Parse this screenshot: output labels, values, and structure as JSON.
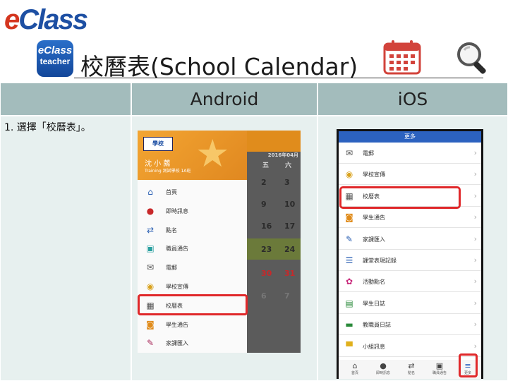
{
  "brand": {
    "e": "e",
    "rest": "Class"
  },
  "teacher_logo": {
    "line1": "eClass",
    "line2": "teacher"
  },
  "title": "校曆表(School Calendar)",
  "table": {
    "col_android": "Android",
    "col_ios": "iOS",
    "step1": "1. 選擇「校曆表」。"
  },
  "android": {
    "school_logo": "學校",
    "user_name": "沈 小 薦",
    "user_sub": "Training 測試學校 1A班",
    "calendar": {
      "month_label": "2016年04月",
      "weekdays": [
        "五",
        "六"
      ],
      "rows": [
        [
          "2",
          "3"
        ],
        [
          "9",
          "10"
        ],
        [
          "16",
          "17"
        ],
        [
          "23",
          "24"
        ],
        [
          "30",
          "31"
        ],
        [
          "6",
          "7"
        ]
      ]
    },
    "menu": [
      {
        "icon": "home-icon",
        "glyph": "⌂",
        "color": "#2a5fb3",
        "label": "首頁"
      },
      {
        "icon": "alert-icon",
        "glyph": "●",
        "color": "#c8282a",
        "label": "即時訊息"
      },
      {
        "icon": "swap-icon",
        "glyph": "⇄",
        "color": "#2a5fb3",
        "label": "點名"
      },
      {
        "icon": "notice-icon",
        "glyph": "▣",
        "color": "#2aa0a0",
        "label": "職員通告"
      },
      {
        "icon": "mail-icon",
        "glyph": "✉",
        "color": "#555555",
        "label": "電郵"
      },
      {
        "icon": "broadcast-icon",
        "glyph": "◉",
        "color": "#d9a21d",
        "label": "學校宣傳"
      },
      {
        "icon": "calendar-icon",
        "glyph": "▦",
        "color": "#555555",
        "label": "校曆表"
      },
      {
        "icon": "student-notice-icon",
        "glyph": "◙",
        "color": "#e08c1c",
        "label": "學生通告"
      },
      {
        "icon": "homework-icon",
        "glyph": "✎",
        "color": "#a8285a",
        "label": "家課匯入"
      }
    ]
  },
  "ios": {
    "header": "更多",
    "rows": [
      {
        "icon": "mail-icon",
        "glyph": "✉",
        "color": "#555555",
        "label": "電郵"
      },
      {
        "icon": "broadcast-icon",
        "glyph": "◉",
        "color": "#d9a21d",
        "label": "學校宣傳"
      },
      {
        "icon": "calendar-icon",
        "glyph": "▦",
        "color": "#555555",
        "label": "校曆表"
      },
      {
        "icon": "student-notice-icon",
        "glyph": "◙",
        "color": "#e08c1c",
        "label": "學生通告"
      },
      {
        "icon": "homework-icon",
        "glyph": "✎",
        "color": "#2a5fb3",
        "label": "家課匯入"
      },
      {
        "icon": "conduct-icon",
        "glyph": "☰",
        "color": "#2a5fb3",
        "label": "課堂表現記錄"
      },
      {
        "icon": "activity-icon",
        "glyph": "✿",
        "color": "#c8287a",
        "label": "活動點名"
      },
      {
        "icon": "diary-icon",
        "glyph": "▤",
        "color": "#2a8a3a",
        "label": "學生日誌"
      },
      {
        "icon": "ebook-icon",
        "glyph": "▬",
        "color": "#2a8a3a",
        "label": "教職員日誌"
      },
      {
        "icon": "group-message-icon",
        "glyph": "▀",
        "color": "#e0b01c",
        "label": "小組訊息"
      }
    ],
    "tabs": [
      {
        "icon": "home-icon",
        "glyph": "⌂",
        "label": "首頁"
      },
      {
        "icon": "alert-icon",
        "glyph": "●",
        "label": "即時訊息"
      },
      {
        "icon": "swap-icon",
        "glyph": "⇄",
        "label": "點名"
      },
      {
        "icon": "notice-icon",
        "glyph": "▣",
        "label": "職員通告"
      },
      {
        "icon": "more-icon",
        "glyph": "≡",
        "label": "更多"
      }
    ]
  },
  "colors": {
    "highlight": "#e0282a",
    "brand_blue": "#1d4fa3",
    "header_bg": "#a3bcbc",
    "cell_bg": "#e7f0ef"
  }
}
